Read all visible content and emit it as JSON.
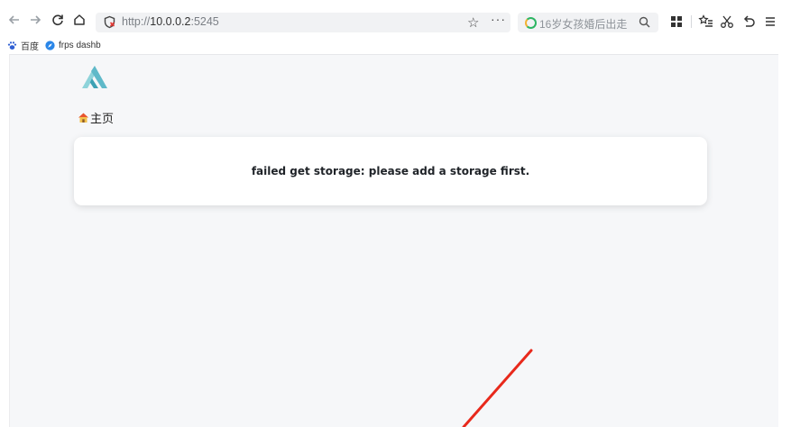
{
  "browser": {
    "address_bar": {
      "url_prefix": "http://",
      "url_host": "10.0.0.2",
      "url_port": ":5245"
    },
    "search_box": {
      "placeholder": "16岁女孩婚后出走"
    },
    "bookmarks": [
      {
        "label": "百度",
        "icon": "baidu-paw-icon"
      },
      {
        "label": "frps dashb",
        "icon": "compass-icon"
      }
    ]
  },
  "page": {
    "home_link": "主页",
    "error_message": "failed get storage: please add a storage first."
  },
  "colors": {
    "accent_teal": "#5fb9c9",
    "annotation_arrow": "#e8291c",
    "page_background": "#f6f7f9"
  }
}
